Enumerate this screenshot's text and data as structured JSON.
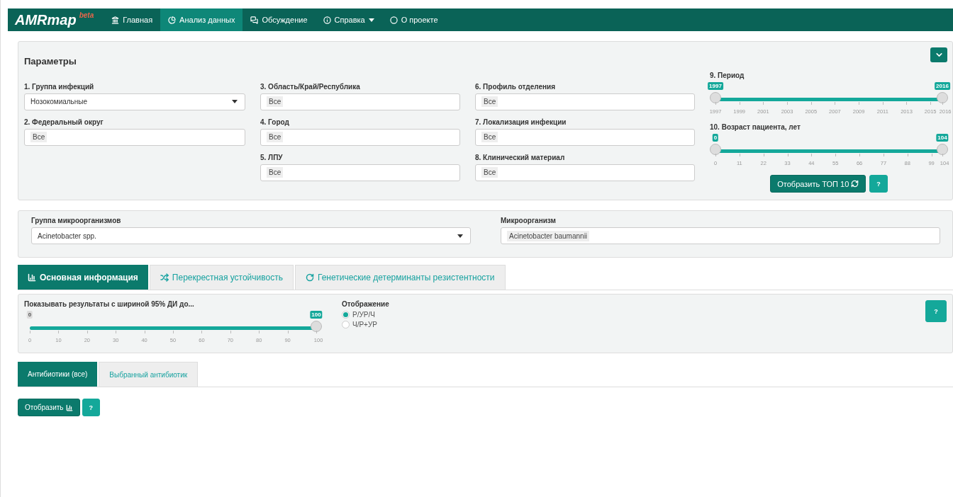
{
  "navbar": {
    "logo": "AMRmap",
    "logo_badge": "beta",
    "items": [
      {
        "label": "Главная",
        "selected": false,
        "dropdown": false
      },
      {
        "label": "Анализ данных",
        "selected": true,
        "dropdown": false
      },
      {
        "label": "Обсуждение",
        "selected": false,
        "dropdown": false
      },
      {
        "label": "Справка",
        "selected": false,
        "dropdown": true
      },
      {
        "label": "О проекте",
        "selected": false,
        "dropdown": false
      }
    ]
  },
  "parameters": {
    "title": "Параметры",
    "expanded": true,
    "columns": [
      [
        {
          "label": "1. Группа инфекций",
          "kind": "select",
          "value": "Нозокомиальные"
        },
        {
          "label": "2. Федеральный округ",
          "kind": "tags",
          "value": "Все"
        }
      ],
      [
        {
          "label": "3. Область/Край/Республика",
          "kind": "tags",
          "value": "Все"
        },
        {
          "label": "4. Город",
          "kind": "tags",
          "value": "Все"
        },
        {
          "label": "5. ЛПУ",
          "kind": "tags",
          "value": "Все"
        }
      ],
      [
        {
          "label": "6. Профиль отделения",
          "kind": "tags",
          "value": "Все"
        },
        {
          "label": "7. Локализация инфекции",
          "kind": "tags",
          "value": "Все"
        },
        {
          "label": "8. Клинический материал",
          "kind": "tags",
          "value": "Все"
        }
      ]
    ],
    "sliders": [
      {
        "label": "9. Период",
        "from": "1997",
        "to": "2016",
        "level": 1,
        "ticks": [
          "1997",
          "1999",
          "2001",
          "2003",
          "2005",
          "2007",
          "2009",
          "2011",
          "2013",
          "2015",
          "2016"
        ]
      },
      {
        "label": "10. Возраст пациента, лет",
        "from": "0",
        "to": "104",
        "level": 1,
        "ticks": [
          "0",
          "11",
          "22",
          "33",
          "44",
          "55",
          "66",
          "77",
          "88",
          "99",
          "104"
        ]
      }
    ],
    "top_button": "Отобразить ТОП 10",
    "help_button": "?"
  },
  "organisms": [
    {
      "label": "Группа микроорганизмов",
      "kind": "select",
      "value": "Acinetobacter spp."
    },
    {
      "label": "Микроорганизм",
      "kind": "tags",
      "value": "Acinetobacter baumannii"
    }
  ],
  "tabs": [
    {
      "label": "Основная информация",
      "selected": true
    },
    {
      "label": "Перекрестная устойчивость",
      "selected": false
    },
    {
      "label": "Генетические детерминанты резистентности",
      "selected": false
    }
  ],
  "ci_filter": {
    "label": "Показывать результаты с шириной 95% ДИ до...",
    "min": "0",
    "value": "100",
    "level": 1,
    "ticks": [
      "0",
      "10",
      "20",
      "30",
      "40",
      "50",
      "60",
      "70",
      "80",
      "90",
      "100"
    ]
  },
  "display": {
    "label": "Отображение",
    "options": [
      {
        "label": "Р/УР/Ч",
        "selected": true
      },
      {
        "label": "Ч/Р+УР",
        "selected": false
      }
    ],
    "help_button": "?"
  },
  "subtabs": [
    {
      "label": "Антибиотики (все)",
      "selected": true
    },
    {
      "label": "Выбранный антибиотик",
      "selected": false
    }
  ],
  "actions": {
    "show_button": "Отобразить",
    "help_button": "?"
  }
}
